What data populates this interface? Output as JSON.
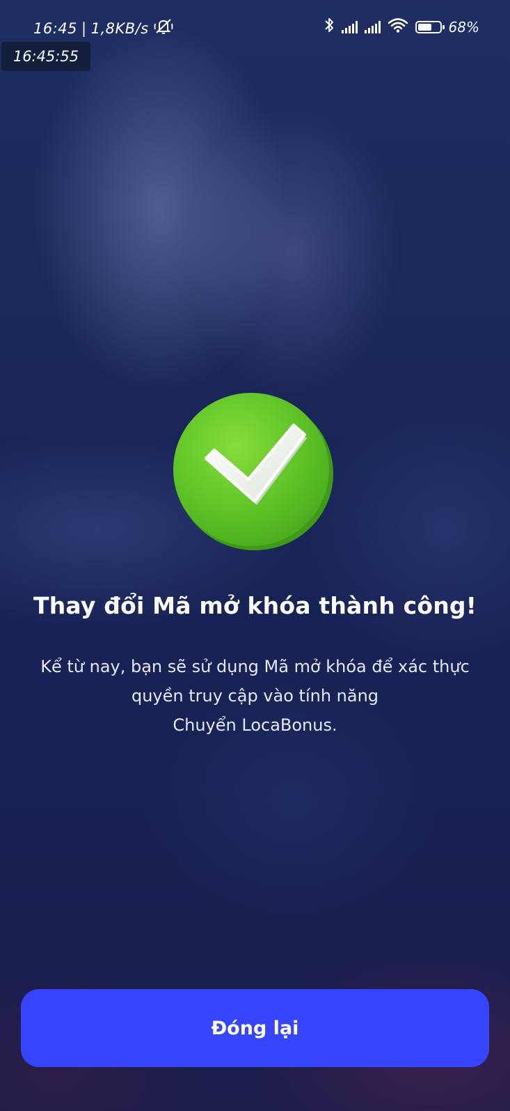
{
  "status_bar": {
    "time": "16:45",
    "separator": "|",
    "network_speed": "1,8KB/s",
    "battery_percent": "68%",
    "battery_level": 0.68,
    "icons": [
      "mute-bell-icon",
      "bluetooth-icon",
      "signal-icon",
      "signal-icon",
      "wifi-icon",
      "battery-icon"
    ]
  },
  "clock_overlay": "16:45:55",
  "success": {
    "icon": "check-circle-icon",
    "title": "Thay đổi Mã mở khóa thành công!",
    "message_lines": [
      "Kể từ nay, bạn sẽ sử dụng Mã mở khóa để xác thực",
      "quyền truy cập vào tính năng",
      "Chuyển LocaBonus."
    ]
  },
  "actions": {
    "close_label": "Đóng lại"
  },
  "colors": {
    "button": "#3645ff",
    "check_green": "#5cc226",
    "background": "#182050"
  }
}
